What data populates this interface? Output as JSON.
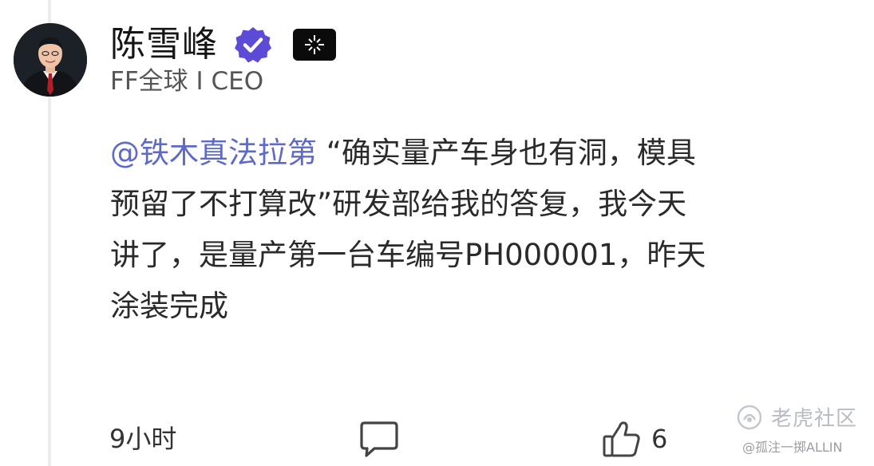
{
  "author": {
    "name": "陈雪峰",
    "subtitle": "FF全球 I CEO",
    "verified_icon": "verified-icon",
    "brand_icon": "ff-logo-icon",
    "accent_color": "#5b4bd6"
  },
  "post": {
    "mention": "@铁木真法拉第",
    "lines": [
      " “确实量产车身也有洞，模具",
      "预留了不打算改”研发部给我的答复，我今天",
      "讲了，是量产第一台车编号PH000001，昨天",
      "涂装完成"
    ],
    "mention_color": "#5d6ac7"
  },
  "footer": {
    "time": "9小时",
    "comment_icon": "comment-icon",
    "like_icon": "thumbs-up-icon",
    "like_count": "6"
  },
  "watermark": {
    "title": "老虎社区",
    "user": "@孤注一掷ALLIN"
  }
}
